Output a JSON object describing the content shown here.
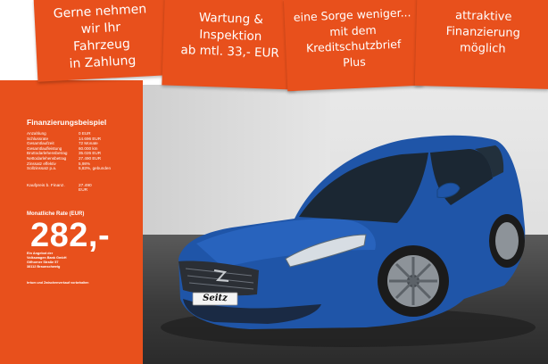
{
  "banners": [
    {
      "lines": [
        "Gerne nehmen",
        "wir Ihr",
        "Fahrzeug",
        "in Zahlung"
      ]
    },
    {
      "lines": [
        "Wartung &",
        "Inspektion",
        "ab mtl. 33,- EUR"
      ]
    },
    {
      "lines": [
        "eine Sorge weniger...",
        "mit dem",
        "Kreditschutzbrief",
        "Plus"
      ]
    },
    {
      "lines": [
        "attraktive",
        "Finanzierung",
        "möglich"
      ]
    }
  ],
  "financing": {
    "title": "Finanzierungsbeispiel",
    "rows": [
      {
        "label": "Anzahlung",
        "value": "0 EUR"
      },
      {
        "label": "Schlussrate",
        "value": "14.696 EUR"
      },
      {
        "label": "Gesamtlaufzeit",
        "value": "72 Monate"
      },
      {
        "label": "Gesamtlaufleistung",
        "value": "60.000 km"
      },
      {
        "label": "Bruttodarlehensbetrag",
        "value": "35.026 EUR"
      },
      {
        "label": "Nettodarlehensbetrag",
        "value": "27.490 EUR"
      },
      {
        "label": "Zinssatz effektiv",
        "value": "5,98%"
      },
      {
        "label": "Sollzinssatz p.a.",
        "value": "5,83%, gebunden"
      }
    ],
    "purchase_label": "Kaufpreis b. Finanz.",
    "purchase_value": "27.490 EUR",
    "rate_label": "Monatliche Rate (EUR)",
    "rate_value": "282,-",
    "lender_lines": [
      "Ein Angebot der",
      "Volkswagen Bank GmbH",
      "Gifhorner Straße 57",
      "38112 Braunschweig"
    ],
    "footnote": "Irrtum und Zwischenverkauf vorbehalten"
  },
  "plate_text": "Seitz",
  "colors": {
    "brand_orange": "#e8501c",
    "car_blue": "#1f55a8"
  }
}
